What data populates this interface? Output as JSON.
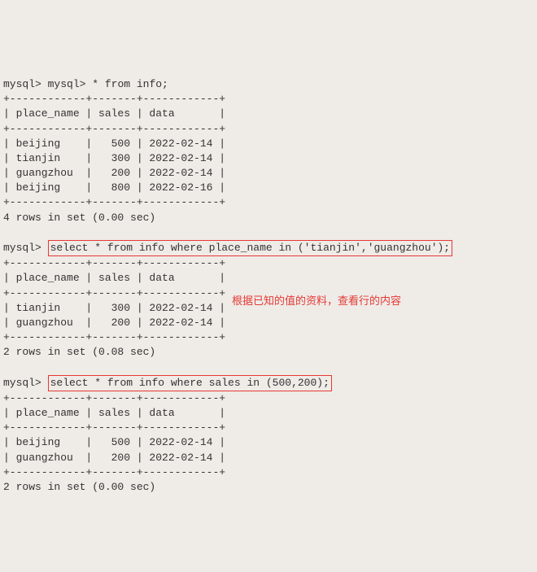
{
  "prompt": "mysql>",
  "query1": {
    "prefix": "mysql> ",
    "text": "* from info;",
    "divider": "+------------+-------+------------+",
    "header": "| place_name | sales | data       |",
    "rows": [
      "| beijing    |   500 | 2022-02-14 |",
      "| tianjin    |   300 | 2022-02-14 |",
      "| guangzhou  |   200 | 2022-02-14 |",
      "| beijing    |   800 | 2022-02-16 |"
    ],
    "footer": "4 rows in set (0.00 sec)"
  },
  "query2": {
    "text": "select * from info where place_name in ('tianjin','guangzhou');",
    "divider": "+------------+-------+------------+",
    "header": "| place_name | sales | data       |",
    "rows": [
      "| tianjin    |   300 | 2022-02-14 |",
      "| guangzhou  |   200 | 2022-02-14 |"
    ],
    "footer": "2 rows in set (0.08 sec)",
    "annotation": "根据已知的值的资料，查看行的内容"
  },
  "query3": {
    "text": "select * from info where sales in (500,200);",
    "divider": "+------------+-------+------------+",
    "header": "| place_name | sales | data       |",
    "rows": [
      "| beijing    |   500 | 2022-02-14 |",
      "| guangzhou  |   200 | 2022-02-14 |"
    ],
    "footer": "2 rows in set (0.00 sec)"
  }
}
